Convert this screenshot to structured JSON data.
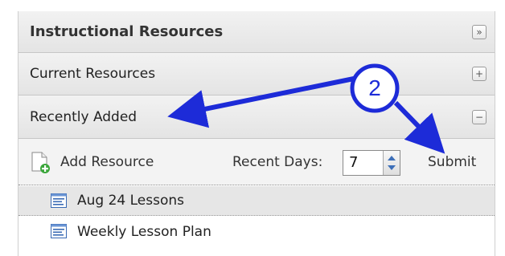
{
  "panel": {
    "title": "Instructional Resources",
    "sections": [
      {
        "label": "Current Resources",
        "toggle": "+"
      },
      {
        "label": "Recently Added",
        "toggle": "−"
      }
    ],
    "collapse_toggle": "»"
  },
  "toolbar": {
    "add_label": "Add Resource",
    "days_label": "Recent Days:",
    "days_value": "7",
    "submit_label": "Submit"
  },
  "list": {
    "items": [
      {
        "label": "Aug 24 Lessons"
      },
      {
        "label": "Weekly Lesson Plan"
      }
    ]
  },
  "callout": {
    "number": "2",
    "color": "#1d2bd8"
  }
}
